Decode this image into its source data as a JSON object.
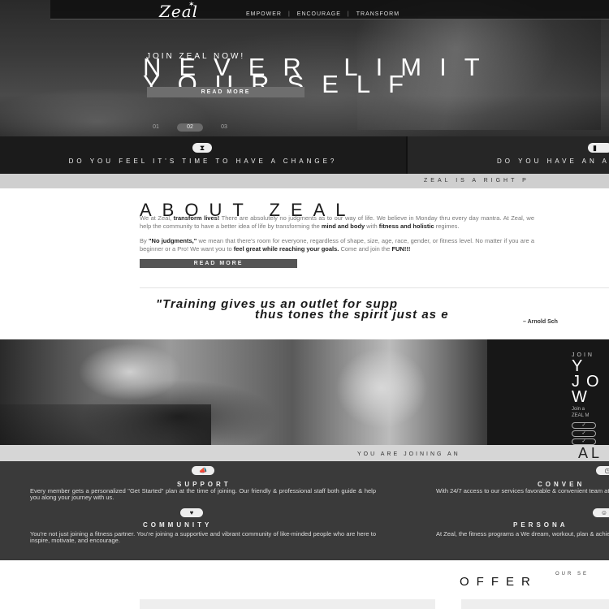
{
  "nav": {
    "logo": "Zeal",
    "tagline": [
      "EMPOWER",
      "ENCOURAGE",
      "TRANSFORM"
    ],
    "separator": "|"
  },
  "hero": {
    "kicker": "JOIN ZEAL NOW!",
    "title_line1": "NEVER LIMIT",
    "title_line2": "YOURSELF",
    "button": "READ MORE",
    "slides": [
      "01",
      "02",
      "03"
    ],
    "active_slide": "02"
  },
  "cta": {
    "left_icon": "hourglass-icon",
    "left_text": "DO YOU FEEL IT'S TIME TO HAVE A CHANGE?",
    "right_icon": "dumbbell-icon",
    "right_text": "DO YOU HAVE AN ACHIEVE YOUR G",
    "banner": "ZEAL IS A RIGHT P"
  },
  "about": {
    "title": "ABOUT ZEAL",
    "p1": [
      {
        "t": "We at Zeal, "
      },
      {
        "b": "transform lives!"
      },
      {
        "t": " There are absolutely no judgments as to our way of life. We believe in Monday thru every day mantra. At Zeal, we help the community to have a better idea of life by transforming the "
      },
      {
        "b": "mind and body"
      },
      {
        "t": " with "
      },
      {
        "b": "fitness and holistic"
      },
      {
        "t": " regimes."
      }
    ],
    "p2": [
      {
        "t": "By "
      },
      {
        "b": "\"No judgments,\""
      },
      {
        "t": " we mean that there's room for everyone, regardless of shape, size, age, race, gender, or fitness level. No matter if you are a beginner or a Pro! We want you to "
      },
      {
        "b": "feel great while reaching your goals."
      },
      {
        "t": " Come and join the "
      },
      {
        "b": "FUN!!!"
      }
    ],
    "button": "READ MORE"
  },
  "quote": {
    "line1": "\"Training gives us an outlet for supp",
    "line2": "thus tones the spirit just as e",
    "author": "– Arnold Sch"
  },
  "join": {
    "kicker": "JOIN",
    "big": [
      "Y",
      "JO",
      "W"
    ],
    "small": [
      "Join a",
      "ZEAL M"
    ],
    "check_icons": [
      "check-icon",
      "check-icon",
      "check-icon",
      "check-icon"
    ]
  },
  "joining": {
    "text": "YOU ARE JOINING AN",
    "big": "AL"
  },
  "features": {
    "support": {
      "icon": "megaphone-icon",
      "title": "SUPPORT",
      "body": "Every member gets a personalized \"Get Started\" plan at the time of joining. Our friendly & professional staff both guide & help you along your journey with us."
    },
    "community": {
      "icon": "heart-icon",
      "title": "COMMUNITY",
      "body": "You're not just joining a fitness partner. You're joining a supportive and vibrant community of like-minded people who are here to inspire, motivate, and encourage."
    },
    "convenience": {
      "icon": "clock-icon",
      "title": "CONVEN",
      "body": "With 24/7 access to our services favorable & convenient team at"
    },
    "personal": {
      "icon": "person-icon",
      "title": "PERSONA",
      "body": "At Zeal, the fitness programs a We dream, workout, plan & achie"
    }
  },
  "offers": {
    "kicker": "OUR SE",
    "title": "OFFER"
  }
}
